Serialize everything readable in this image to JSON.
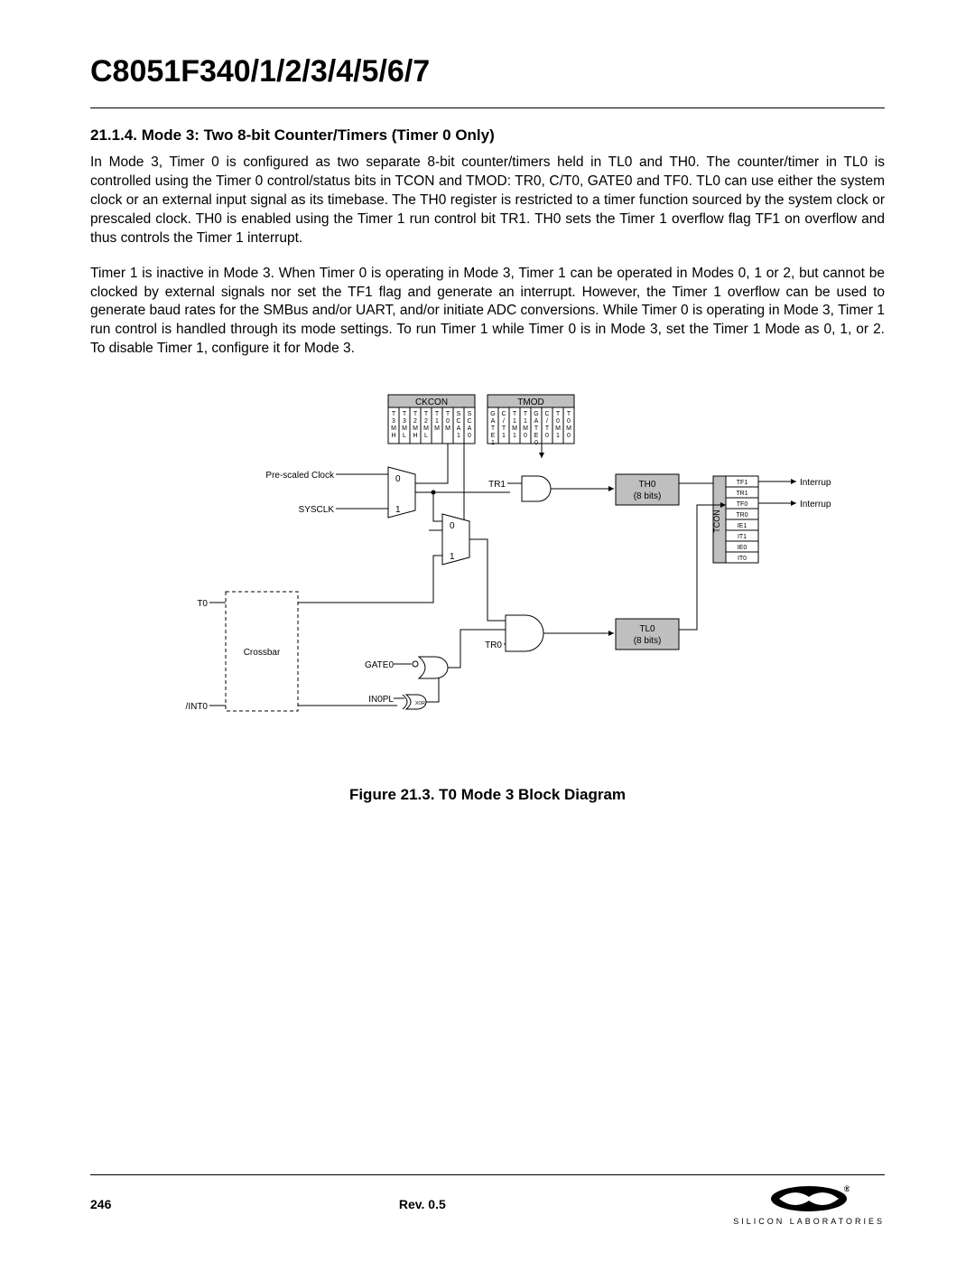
{
  "header": {
    "doc_title": "C8051F340/1/2/3/4/5/6/7"
  },
  "section": {
    "heading": "21.1.4. Mode 3: Two 8-bit Counter/Timers (Timer 0 Only)",
    "p1": "In Mode 3, Timer 0 is configured as two separate 8-bit counter/timers held in TL0 and TH0. The counter/timer in TL0 is controlled using the Timer 0 control/status bits in TCON and TMOD: TR0, C/T0, GATE0 and TF0. TL0 can use either the system clock or an external input signal as its timebase. The TH0 register is restricted to a timer function sourced by the system clock or prescaled clock. TH0 is enabled using the Timer 1 run control bit TR1. TH0 sets the Timer 1 overflow flag TF1 on overflow and thus controls the Timer 1 interrupt.",
    "p2": "Timer 1 is inactive in Mode 3. When Timer 0 is operating in Mode 3, Timer 1 can be operated in Modes 0, 1 or 2, but cannot be clocked by external signals nor set the TF1 flag and generate an interrupt. However, the Timer 1 overflow can be used to generate baud rates for the SMBus and/or UART, and/or initiate ADC conversions. While Timer 0 is operating in Mode 3, Timer 1 run control is handled through its mode settings. To run Timer 1 while Timer 0 is in Mode 3, set the Timer 1 Mode as 0, 1, or 2. To disable Timer 1, configure it for Mode 3."
  },
  "figure": {
    "caption": "Figure 21.3. T0 Mode 3 Block Diagram",
    "reg_ckcon": {
      "title": "CKCON",
      "cells": [
        "T3MH",
        "T3ML",
        "T2MH",
        "T2ML",
        "T1M",
        "T0M",
        "SCA1",
        "SCA0"
      ]
    },
    "reg_tmod": {
      "title": "TMOD",
      "cells": [
        "GATE1",
        "C/T1",
        "T1M1",
        "T1M0",
        "GATE0",
        "C/T0",
        "T0M1",
        "T0M0"
      ]
    },
    "reg_tcon": {
      "title": "TCON",
      "cells": [
        "TF1",
        "TR1",
        "TF0",
        "TR0",
        "IE1",
        "IT1",
        "IE0",
        "IT0"
      ]
    },
    "inputs": {
      "prescaled": "Pre-scaled Clock",
      "sysclk": "SYSCLK",
      "t0": "T0",
      "crossbar": "Crossbar",
      "int0": "/INT0"
    },
    "signals": {
      "tr1": "TR1",
      "tr0": "TR0",
      "gate0": "GATE0",
      "in0pl": "IN0PL",
      "xor": "XOR"
    },
    "blocks": {
      "th0": "TH0",
      "tl0": "TL0",
      "bits": "(8 bits)"
    },
    "outputs": {
      "interrupt": "Interrupt"
    },
    "mux": {
      "zero": "0",
      "one": "1"
    }
  },
  "footer": {
    "page": "246",
    "rev": "Rev. 0.5",
    "brand": "SILICON LABORATORIES"
  }
}
